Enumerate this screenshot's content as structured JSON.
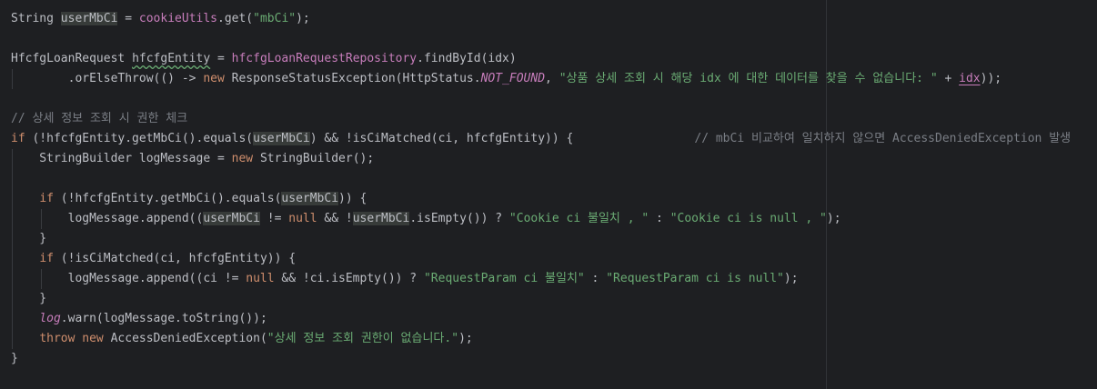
{
  "editor": {
    "lines": [
      {
        "id": "l1",
        "segments": [
          {
            "t": "String "
          },
          {
            "t": "userMbCi",
            "c": "hl"
          },
          {
            "t": " = "
          },
          {
            "t": "cookieUtils",
            "c": "field"
          },
          {
            "t": ".get("
          },
          {
            "t": "\"mbCi\"",
            "c": "str"
          },
          {
            "t": ");"
          }
        ]
      },
      {
        "id": "l2",
        "segments": []
      },
      {
        "id": "l3",
        "segments": [
          {
            "t": "HfcfgLoanRequest "
          },
          {
            "t": "hfcfgEntity",
            "c": "squig"
          },
          {
            "t": " = "
          },
          {
            "t": "hfcfgLoanRequestRepository",
            "c": "field"
          },
          {
            "t": ".findById(idx)"
          }
        ]
      },
      {
        "id": "l4",
        "segments": [
          {
            "t": "        .orElseThrow(() -> "
          },
          {
            "t": "new",
            "c": "kw"
          },
          {
            "t": " ResponseStatusException(HttpStatus."
          },
          {
            "t": "NOT_FOUND",
            "c": "const"
          },
          {
            "t": ", "
          },
          {
            "t": "\"상품 상세 조회 시 해당 idx 에 대한 데이터를 찾을 수 없습니다: \"",
            "c": "str"
          },
          {
            "t": " + "
          },
          {
            "t": "idx",
            "c": "field ul"
          },
          {
            "t": "));"
          }
        ]
      },
      {
        "id": "l5",
        "segments": []
      },
      {
        "id": "l6",
        "segments": [
          {
            "t": "// 상세 정보 조회 시 권한 체크",
            "c": "cmt"
          }
        ]
      },
      {
        "id": "l7",
        "segments": [
          {
            "t": "if",
            "c": "kw"
          },
          {
            "t": " (!hfcfgEntity.getMbCi().equals("
          },
          {
            "t": "userMbCi",
            "c": "hl"
          },
          {
            "t": ") && !isCiMatched(ci, hfcfgEntity)) {                 "
          },
          {
            "t": "// mbCi 비교하여 일치하지 않으면 AccessDeniedException 발생",
            "c": "cmt"
          }
        ]
      },
      {
        "id": "l8",
        "segments": [
          {
            "t": "    StringBuilder logMessage = "
          },
          {
            "t": "new",
            "c": "kw"
          },
          {
            "t": " StringBuilder();"
          }
        ]
      },
      {
        "id": "l9",
        "segments": []
      },
      {
        "id": "l10",
        "segments": [
          {
            "t": "    "
          },
          {
            "t": "if",
            "c": "kw"
          },
          {
            "t": " (!hfcfgEntity.getMbCi().equals("
          },
          {
            "t": "userMbCi",
            "c": "hl"
          },
          {
            "t": ")) {"
          }
        ]
      },
      {
        "id": "l11",
        "segments": [
          {
            "t": "        logMessage.append(("
          },
          {
            "t": "userMbCi",
            "c": "hl"
          },
          {
            "t": " != "
          },
          {
            "t": "null",
            "c": "kw"
          },
          {
            "t": " && !"
          },
          {
            "t": "userMbCi",
            "c": "hl"
          },
          {
            "t": ".isEmpty()) ? "
          },
          {
            "t": "\"Cookie ci 불일치 , \"",
            "c": "str"
          },
          {
            "t": " : "
          },
          {
            "t": "\"Cookie ci is null , \"",
            "c": "str"
          },
          {
            "t": ");"
          }
        ]
      },
      {
        "id": "l12",
        "segments": [
          {
            "t": "    }"
          }
        ]
      },
      {
        "id": "l13",
        "segments": [
          {
            "t": "    "
          },
          {
            "t": "if",
            "c": "kw"
          },
          {
            "t": " (!isCiMatched(ci, hfcfgEntity)) {"
          }
        ]
      },
      {
        "id": "l14",
        "segments": [
          {
            "t": "        logMessage.append((ci != "
          },
          {
            "t": "null",
            "c": "kw"
          },
          {
            "t": " && !ci.isEmpty()) ? "
          },
          {
            "t": "\"RequestParam ci 불일치\"",
            "c": "str"
          },
          {
            "t": " : "
          },
          {
            "t": "\"RequestParam ci is null\"",
            "c": "str"
          },
          {
            "t": ");"
          }
        ]
      },
      {
        "id": "l15",
        "segments": [
          {
            "t": "    }"
          }
        ]
      },
      {
        "id": "l16",
        "segments": [
          {
            "t": "    "
          },
          {
            "t": "log",
            "c": "logf"
          },
          {
            "t": ".warn(logMessage.toString());"
          }
        ]
      },
      {
        "id": "l17",
        "segments": [
          {
            "t": "    "
          },
          {
            "t": "throw",
            "c": "kw"
          },
          {
            "t": " "
          },
          {
            "t": "new",
            "c": "kw"
          },
          {
            "t": " AccessDeniedException("
          },
          {
            "t": "\"상세 정보 조회 권한이 없습니다.\"",
            "c": "str"
          },
          {
            "t": ");"
          }
        ]
      },
      {
        "id": "l18",
        "segments": [
          {
            "t": "}"
          }
        ]
      }
    ]
  }
}
